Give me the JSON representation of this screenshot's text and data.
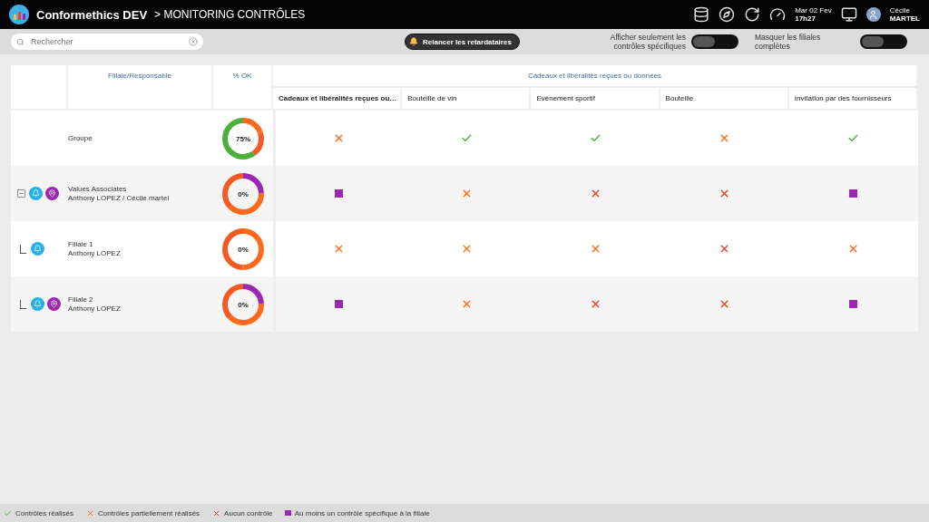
{
  "app": {
    "name": "Conformethics DEV",
    "breadcrumb_separator": ">",
    "page_title": "MONITORING CONTRÔLES"
  },
  "header": {
    "date": "Mar 02 Fev",
    "time": "17h27",
    "user_first": "Cécile",
    "user_last": "MARTEL"
  },
  "toolbar": {
    "search": {
      "placeholder": "Rechercher"
    },
    "remind_button": "Relancer les retardataires",
    "toggles": [
      {
        "label": "Afficher seulement les contrôles spécifiques",
        "on": false
      },
      {
        "label": "Masquer les filiales complètes",
        "on": false
      }
    ]
  },
  "table": {
    "columns": {
      "entity": "Filiale/Responsable",
      "ok": "% OK",
      "group": "Cadeaux et libéralités reçues ou données"
    },
    "controls": [
      {
        "label": "Cadeaux et libéralités reçues ou…",
        "bold": true
      },
      {
        "label": "Bouteille de vin",
        "bold": false
      },
      {
        "label": "Evènement sportif",
        "bold": false
      },
      {
        "label": "Bouteille",
        "bold": false
      },
      {
        "label": "Invitation par des fournisseurs",
        "bold": false
      }
    ],
    "rows": [
      {
        "kind": "group",
        "bell": false,
        "pin": false,
        "lines": [
          "Groupe"
        ],
        "ok": "75%",
        "statuses": [
          {
            "kind": "partial"
          },
          {
            "kind": "done"
          },
          {
            "kind": "done"
          },
          {
            "kind": "partial"
          },
          {
            "kind": "done"
          }
        ]
      },
      {
        "kind": "parent",
        "bell": true,
        "pin": true,
        "lines": [
          "Values Associates",
          "Anthony LOPEZ / Cécile martel"
        ],
        "ok": "0%",
        "statuses": [
          {
            "kind": "specific"
          },
          {
            "kind": "partial"
          },
          {
            "kind": "none"
          },
          {
            "kind": "none"
          },
          {
            "kind": "specific"
          }
        ]
      },
      {
        "kind": "child",
        "bell": true,
        "pin": false,
        "lines": [
          "Filiale 1",
          "Anthony LOPEZ"
        ],
        "ok": "0%",
        "statuses": [
          {
            "kind": "partial"
          },
          {
            "kind": "partial"
          },
          {
            "kind": "partial"
          },
          {
            "kind": "none"
          },
          {
            "kind": "partial"
          }
        ]
      },
      {
        "kind": "child",
        "bell": true,
        "pin": true,
        "lines": [
          "Filiale 2",
          "Anthony LOPEZ"
        ],
        "ok": "0%",
        "statuses": [
          {
            "kind": "specific"
          },
          {
            "kind": "partial"
          },
          {
            "kind": "none"
          },
          {
            "kind": "none"
          },
          {
            "kind": "specific"
          }
        ]
      }
    ]
  },
  "legend": [
    {
      "kind": "done",
      "label": "Contrôles réalisés"
    },
    {
      "kind": "partial",
      "label": "Contrôles partiellement réalisés"
    },
    {
      "kind": "none",
      "label": "Aucun contrôle"
    },
    {
      "kind": "specific",
      "label": "Au moins un contrôle spécifique à la filiale"
    }
  ]
}
